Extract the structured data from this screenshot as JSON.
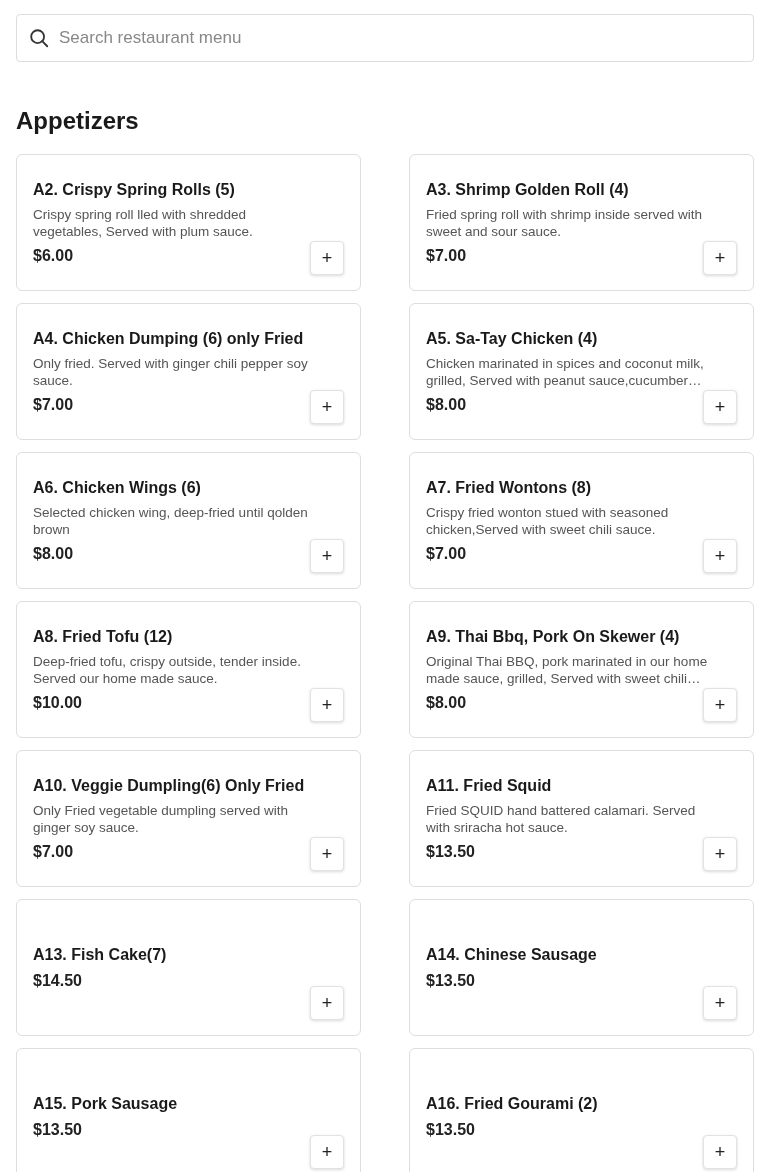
{
  "search": {
    "placeholder": "Search restaurant menu"
  },
  "section": {
    "title": "Appetizers",
    "items": [
      {
        "name": "A2. Crispy Spring Rolls (5)",
        "description": "Crispy spring roll lled with shredded vegetables, Served with plum sauce.",
        "price": "$6.00",
        "add": "+"
      },
      {
        "name": "A3. Shrimp Golden Roll (4)",
        "description": "Fried spring roll with shrimp inside served with sweet and sour sauce.",
        "price": "$7.00",
        "add": "+"
      },
      {
        "name": "A4. Chicken Dumping (6) only Fried",
        "description": "Only fried. Served with ginger chili pepper soy sauce.",
        "price": "$7.00",
        "add": "+"
      },
      {
        "name": "A5. Sa-Tay Chicken (4)",
        "description": "Chicken marinated in spices and coconut milk, grilled, Served with peanut sauce,cucumber…",
        "price": "$8.00",
        "add": "+"
      },
      {
        "name": "A6. Chicken Wings (6)",
        "description": "Selected chicken wing, deep-fried until qolden brown",
        "price": "$8.00",
        "add": "+"
      },
      {
        "name": "A7. Fried Wontons (8)",
        "description": "Crispy fried wonton stued with seasoned chicken,Served with sweet chili sauce.",
        "price": "$7.00",
        "add": "+"
      },
      {
        "name": "A8. Fried Tofu (12)",
        "description": "Deep-fried tofu, crispy outside, tender inside. Served our home made sauce.",
        "price": "$10.00",
        "add": "+"
      },
      {
        "name": "A9. Thai Bbq, Pork On Skewer (4)",
        "description": "Original Thai BBQ, pork marinated in our home made sauce, grilled, Served with sweet chili…",
        "price": "$8.00",
        "add": "+"
      },
      {
        "name": "A10. Veggie Dumpling(6) Only Fried",
        "description": "Only Fried vegetable dumpling served with ginger soy sauce.",
        "price": "$7.00",
        "add": "+"
      },
      {
        "name": "A11. Fried Squid",
        "description": "Fried SQUID hand battered calamari. Served with sriracha hot sauce.",
        "price": "$13.50",
        "add": "+"
      },
      {
        "name": "A13. Fish Cake(7)",
        "price": "$14.50",
        "add": "+"
      },
      {
        "name": "A14. Chinese Sausage",
        "price": "$13.50",
        "add": "+"
      },
      {
        "name": "A15. Pork Sausage",
        "price": "$13.50",
        "add": "+"
      },
      {
        "name": "A16. Fried Gourami (2)",
        "price": "$13.50",
        "add": "+"
      }
    ]
  }
}
